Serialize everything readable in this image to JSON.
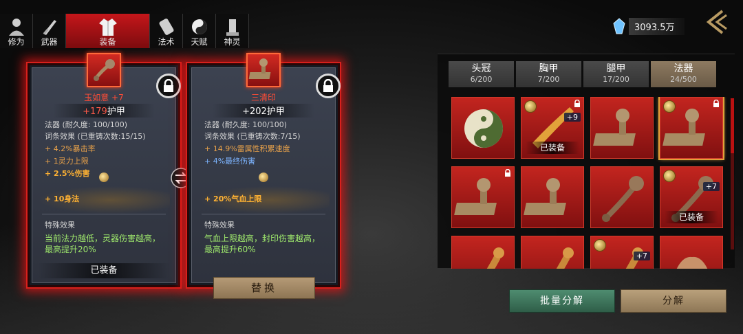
{
  "tabs": [
    {
      "label": "修为",
      "icon": "cultivator-icon"
    },
    {
      "label": "武器",
      "icon": "sword-icon"
    },
    {
      "label": "装备",
      "icon": "robe-icon",
      "active": true
    },
    {
      "label": "法术",
      "icon": "scroll-icon"
    },
    {
      "label": "天赋",
      "icon": "yin-yang-icon"
    },
    {
      "label": "神灵",
      "icon": "shrine-icon"
    }
  ],
  "currency": {
    "value": "3093.5万",
    "icon": "spirit-crystal-icon"
  },
  "left_card": {
    "name": "玉如意 +7",
    "armor_value": "+179",
    "armor_label": "护甲",
    "durability": "法器 (耐久度: 100/100)",
    "affix_header": "词条效果 (已重铸次数:15/15)",
    "affixes": [
      "+ 4.2%暴击率",
      "+ 1灵力上限",
      "+ 2.5%伤害"
    ],
    "bonus": "+ 10身法",
    "special_header": "特殊效果",
    "special_text": "当前法力越低，灵器伤害越高，最高提升20%",
    "status": "已装备"
  },
  "right_card": {
    "name": "三清印",
    "armor_value": "+202",
    "armor_label": "护甲",
    "durability": "法器 (耐久度: 100/100)",
    "affix_header": "词条效果 (已重铸次数:7/15)",
    "affixes": [
      "+ 14.9%雷属性积累速度",
      "+ 4%最终伤害"
    ],
    "bonus": "+ 20%气血上限",
    "special_header": "特殊效果",
    "special_text": "气血上限越高，封印伤害越高，最高提升60%"
  },
  "replace_label": "替换",
  "categories": [
    {
      "name": "头冠",
      "count": "6/200"
    },
    {
      "name": "胸甲",
      "count": "7/200"
    },
    {
      "name": "腿甲",
      "count": "17/200"
    },
    {
      "name": "法器",
      "count": "24/500",
      "active": true
    }
  ],
  "slots": [
    {
      "item": "yin-yang-disc",
      "gem": false,
      "locked": false,
      "plus": "",
      "equipped": ""
    },
    {
      "item": "golden-blade",
      "gem": true,
      "locked": true,
      "plus": "+9",
      "equipped": "已装备"
    },
    {
      "item": "bronze-seal",
      "gem": false,
      "locked": false,
      "plus": "",
      "equipped": ""
    },
    {
      "item": "bronze-seal",
      "gem": true,
      "locked": true,
      "plus": "",
      "equipped": "",
      "selected": true
    },
    {
      "item": "bronze-seal",
      "gem": false,
      "locked": true,
      "plus": "",
      "equipped": ""
    },
    {
      "item": "bronze-seal",
      "gem": false,
      "locked": false,
      "plus": "",
      "equipped": ""
    },
    {
      "item": "ruyi-scepter",
      "gem": false,
      "locked": false,
      "plus": "",
      "equipped": ""
    },
    {
      "item": "ruyi-scepter",
      "gem": true,
      "locked": false,
      "plus": "+7",
      "equipped": "已装备"
    },
    {
      "item": "golden-staff",
      "gem": false,
      "locked": false,
      "plus": "",
      "equipped": ""
    },
    {
      "item": "golden-staff",
      "gem": false,
      "locked": false,
      "plus": "",
      "equipped": ""
    },
    {
      "item": "golden-staff",
      "gem": true,
      "locked": false,
      "plus": "+7",
      "equipped": ""
    },
    {
      "item": "lotus-lamp",
      "gem": false,
      "locked": false,
      "plus": "",
      "equipped": ""
    }
  ],
  "batch_decompose_label": "批量分解",
  "decompose_label": "分解"
}
